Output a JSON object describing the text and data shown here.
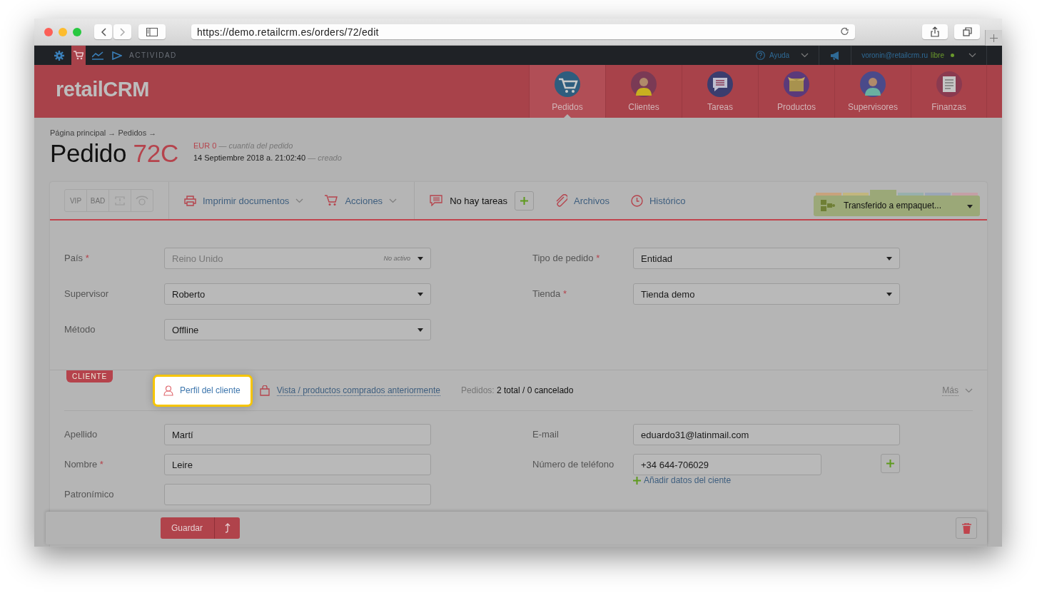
{
  "browser": {
    "url": "https://demo.retailcrm.es/orders/72/edit"
  },
  "topbar": {
    "apps": [
      {
        "kind": "gear",
        "selected": false
      },
      {
        "kind": "cart",
        "selected": true
      },
      {
        "kind": "chart",
        "selected": false
      },
      {
        "kind": "play",
        "selected": false
      }
    ],
    "activity": "ACTIVIDAD",
    "help": "Ayuda",
    "user": "voronin@retailcrm.ru",
    "plan": "libre",
    "online": true
  },
  "header": {
    "logo": "retailCRM",
    "nav": [
      {
        "label": "Pedidos",
        "kind": "cart",
        "selected": true
      },
      {
        "label": "Clientes",
        "kind": "person",
        "selected": false
      },
      {
        "label": "Tareas",
        "kind": "tasks",
        "selected": false
      },
      {
        "label": "Productos",
        "kind": "box",
        "selected": false
      },
      {
        "label": "Supervisores",
        "kind": "person2",
        "selected": false
      },
      {
        "label": "Finanzas",
        "kind": "finance",
        "selected": false
      }
    ]
  },
  "breadcrumb": "Página principal → Pedidos →",
  "order": {
    "title": "Pedido",
    "number": "72C",
    "amount": "EUR 0",
    "amount_note": "— cuantía del pedido",
    "date": "14 Septiembre 2018 a. 21:02:40",
    "date_note": "— creado"
  },
  "toolbar": {
    "flags": [
      {
        "kind": "text",
        "label": "VIP"
      },
      {
        "kind": "text",
        "label": "BAD"
      },
      {
        "kind": "alert"
      },
      {
        "kind": "call"
      }
    ],
    "actions": [
      {
        "kind": "print",
        "label": "Imprimir documentos",
        "dropdown": true
      },
      {
        "kind": "cart",
        "label": "Acciones",
        "dropdown": true
      }
    ],
    "tasks": "No hay tareas",
    "links": [
      {
        "kind": "clip",
        "label": "Archivos"
      },
      {
        "kind": "clock",
        "label": "Histórico"
      }
    ],
    "status": {
      "label": "Transferido a empaquet...",
      "segments": [
        {
          "color": "#c8a27c",
          "selected": false
        },
        {
          "color": "#c2b67e",
          "selected": false
        },
        {
          "color": "#9ba878",
          "selected": true
        },
        {
          "color": "#97b0ac",
          "selected": false
        },
        {
          "color": "#9aa6b6",
          "selected": false
        },
        {
          "color": "#c49fa6",
          "selected": false
        }
      ]
    }
  },
  "order_fields": [
    {
      "label": "País",
      "mark": "*",
      "value": "Reino Unido",
      "note": "No activo",
      "disabled": true,
      "kind": "select"
    },
    {
      "label": "Tipo de pedido",
      "mark": "*",
      "value": "Entidad",
      "disabled": false,
      "kind": "select"
    },
    {
      "label": "Supervisor",
      "value": "Roberto",
      "disabled": false,
      "kind": "select"
    },
    {
      "label": "Tienda",
      "mark": "*",
      "value": "Tienda demo",
      "disabled": false,
      "kind": "select"
    },
    {
      "label": "Método",
      "value": "Offline",
      "disabled": false,
      "kind": "select"
    }
  ],
  "client": {
    "tag": "CLIENTE",
    "profile": {
      "label": "Perfil del cliente",
      "highlighted": true
    },
    "history": "Vista / productos comprados anteriormente",
    "orders_label": "Pedidos:",
    "orders": "2 total / 0 cancelado",
    "more": "Más",
    "fields": [
      {
        "label": "Apellido",
        "value": "Martí",
        "kind": "text"
      },
      {
        "label": "E-mail",
        "value": "eduardo31@latinmail.com",
        "kind": "text"
      },
      {
        "label": "Nombre",
        "mark": "*",
        "value": "Leire",
        "kind": "text"
      },
      {
        "label": "Número de teléfono",
        "value": "+34 644-706029",
        "kind": "phone"
      },
      {
        "label": "Patronímico",
        "kind": "text"
      },
      {
        "kind": "add",
        "label": "Añadir datos del ciente"
      }
    ]
  },
  "footer": {
    "save": "Guardar"
  }
}
